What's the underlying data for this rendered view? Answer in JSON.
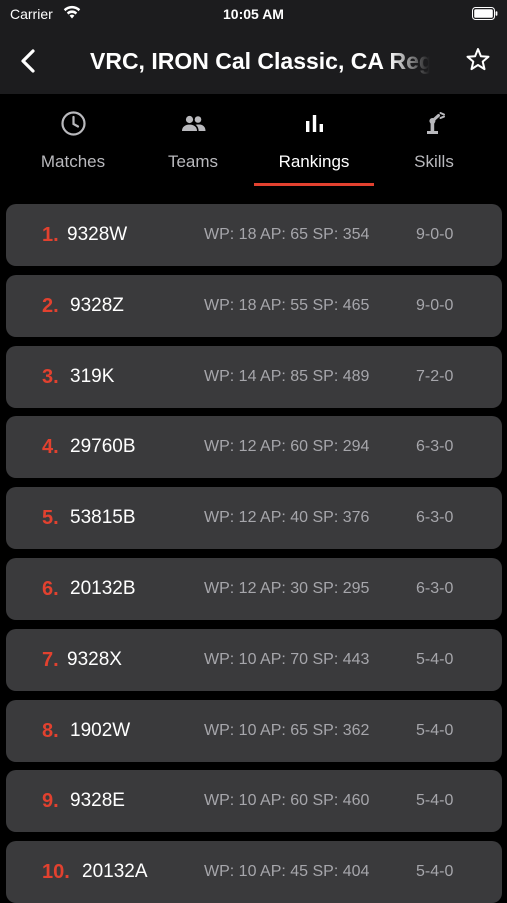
{
  "status_bar": {
    "carrier": "Carrier",
    "time": "10:05 AM"
  },
  "nav": {
    "title": "VRC, IRON Cal Classic, CA Region",
    "back_icon": "chevron-left-icon",
    "favorite_icon": "star-outline-icon"
  },
  "tabs": [
    {
      "label": "Matches",
      "icon": "clock-icon"
    },
    {
      "label": "Teams",
      "icon": "people-icon"
    },
    {
      "label": "Rankings",
      "icon": "bar-chart-icon",
      "active": true
    },
    {
      "label": "Skills",
      "icon": "robot-arm-icon"
    }
  ],
  "accent_color": "#e2412f",
  "rankings": [
    {
      "rank": "1.",
      "team": "9328W",
      "stats": "WP: 18 AP: 65 SP: 354",
      "record": "9-0-0"
    },
    {
      "rank": "2.",
      "team": "9328Z",
      "stats": "WP: 18 AP: 55 SP: 465",
      "record": "9-0-0"
    },
    {
      "rank": "3.",
      "team": "319K",
      "stats": "WP: 14 AP: 85 SP: 489",
      "record": "7-2-0"
    },
    {
      "rank": "4.",
      "team": "29760B",
      "stats": "WP: 12 AP: 60 SP: 294",
      "record": "6-3-0"
    },
    {
      "rank": "5.",
      "team": "53815B",
      "stats": "WP: 12 AP: 40 SP: 376",
      "record": "6-3-0"
    },
    {
      "rank": "6.",
      "team": "20132B",
      "stats": "WP: 12 AP: 30 SP: 295",
      "record": "6-3-0"
    },
    {
      "rank": "7.",
      "team": "9328X",
      "stats": "WP: 10 AP: 70 SP: 443",
      "record": "5-4-0"
    },
    {
      "rank": "8.",
      "team": "1902W",
      "stats": "WP: 10 AP: 65 SP: 362",
      "record": "5-4-0"
    },
    {
      "rank": "9.",
      "team": "9328E",
      "stats": "WP: 10 AP: 60 SP: 460",
      "record": "5-4-0"
    },
    {
      "rank": "10.",
      "team": "20132A",
      "stats": "WP: 10 AP: 45 SP: 404",
      "record": "5-4-0"
    }
  ]
}
